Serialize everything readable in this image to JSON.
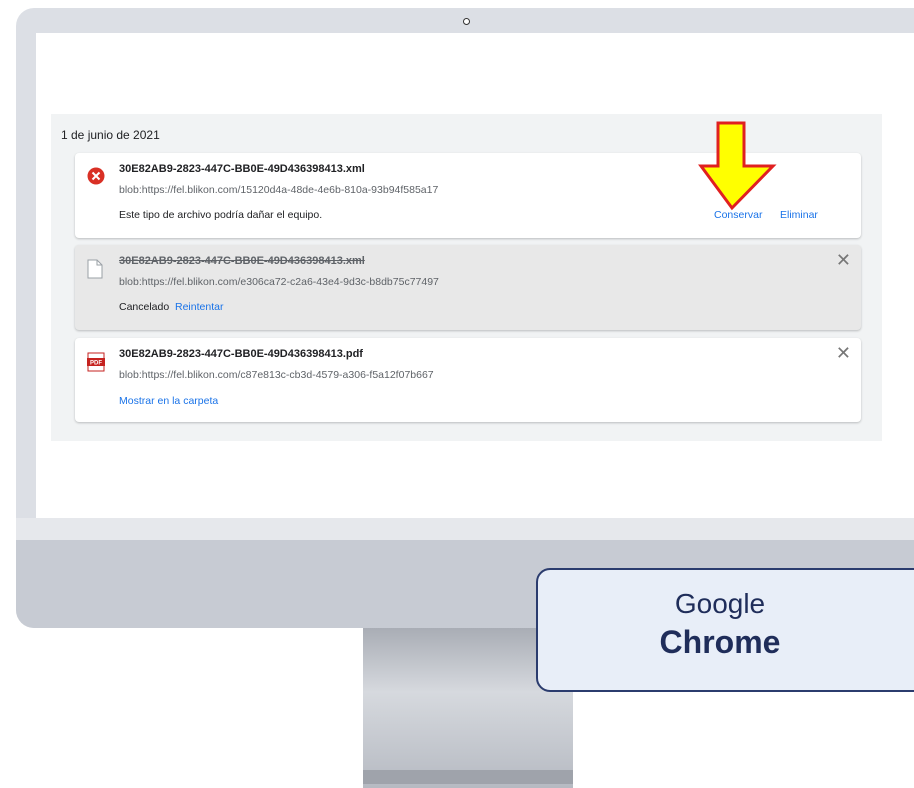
{
  "downloads": {
    "date": "1 de junio de 2021",
    "items": [
      {
        "filename": "30E82AB9-2823-447C-BB0E-49D436398413.xml",
        "url": "blob:https://fel.blikon.com/15120d4a-48de-4e6b-810a-93b94f585a17",
        "status": "Este tipo de archivo podría dañar el equipo.",
        "actions": [
          "Conservar",
          "Eliminar"
        ],
        "icon": "error-icon"
      },
      {
        "filename": "30E82AB9-2823-447C-BB0E-49D436398413.xml",
        "url": "blob:https://fel.blikon.com/e306ca72-c2a6-43e4-9d3c-b8db75c77497",
        "status": "Cancelado",
        "actions": [
          "Reintentar"
        ],
        "icon": "file-icon"
      },
      {
        "filename": "30E82AB9-2823-447C-BB0E-49D436398413.pdf",
        "url": "blob:https://fel.blikon.com/c87e813c-cb3d-4579-a306-f5a12f07b667",
        "actions": [
          "Mostrar en la carpeta"
        ],
        "icon": "pdf-icon",
        "icon_text": "PDF"
      }
    ]
  },
  "badge": {
    "line1": "Google",
    "line2": "Chrome"
  },
  "colors": {
    "link": "#1a73e8",
    "arrow_fill": "#ffff00",
    "arrow_outline": "#e02020",
    "badge_border": "#2b3c6e"
  }
}
